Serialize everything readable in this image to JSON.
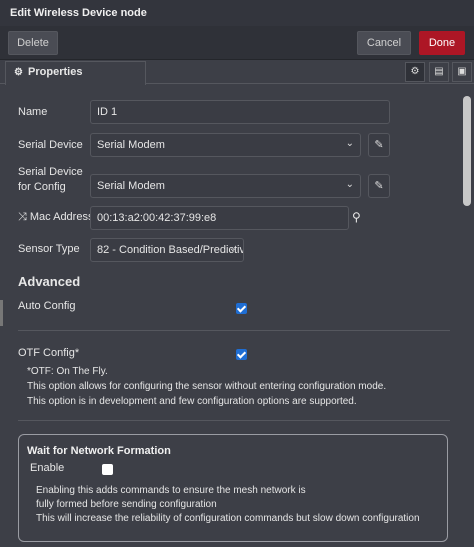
{
  "window": {
    "title": "Edit Wireless Device node"
  },
  "toolbar": {
    "delete_label": "Delete",
    "cancel_label": "Cancel",
    "done_label": "Done",
    "done_color": "#ad1625"
  },
  "tabs": {
    "properties_label": "Properties",
    "properties_icon": "gear-icon",
    "right_icons": [
      "gear-icon",
      "document-icon",
      "frame-icon"
    ]
  },
  "form": {
    "name_label": "Name",
    "name_value": "ID 1",
    "serial_device_label": "Serial Device",
    "serial_device_value": "Serial Modem",
    "serial_config_label_1": "Serial Device",
    "serial_config_label_2": "for Config",
    "serial_config_value": "Serial Modem",
    "mac_label": "Mac Address",
    "mac_value": "00:13:a2:00:42:37:99:e8",
    "sensor_type_label": "Sensor Type",
    "sensor_type_value": "82 - Condition Based/Predictiv"
  },
  "advanced": {
    "heading": "Advanced",
    "auto_config_label": "Auto Config",
    "auto_config_checked": true,
    "otf_label": "OTF Config*",
    "otf_checked": true,
    "otf_note_1": "*OTF: On The Fly.",
    "otf_note_2": "This option allows for configuring the sensor without entering configuration mode.",
    "otf_note_3": "This option is in development and few configuration options are supported."
  },
  "network": {
    "title": "Wait for Network Formation",
    "enable_label": "Enable",
    "enable_checked": false,
    "note_1": "Enabling this adds commands to ensure the mesh network is",
    "note_2": "fully formed before sending configuration",
    "note_3": "This will increase the reliability of configuration commands but slow down configuration"
  }
}
